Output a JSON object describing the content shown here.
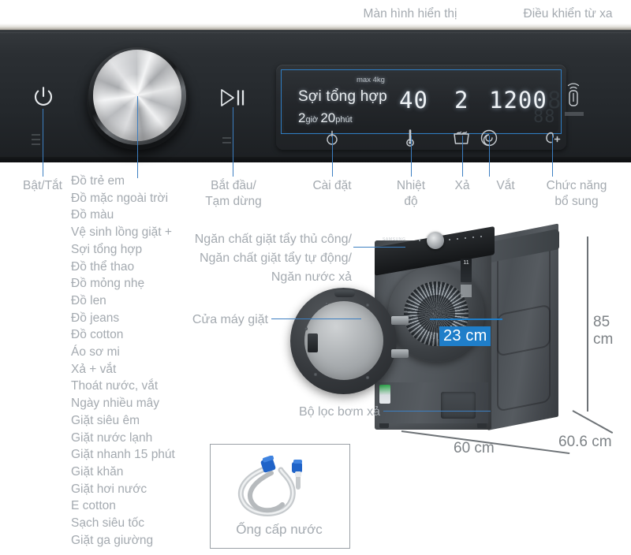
{
  "callouts": {
    "display": "Màn hình hiển thị",
    "remote": "Điều khiển từ xa",
    "power": "Bật/Tắt",
    "start_pause": "Bắt đầu/\nTạm dừng",
    "settings": "Cài đặt",
    "temperature": "Nhiệt\nđộ",
    "rinse": "Xả",
    "spin": "Vắt",
    "extra": "Chức năng\nbổ sung",
    "detergent_drawer": "Ngăn chất giặt tẩy thủ công/\nNgăn chất giặt tẩy tự động/\nNgăn nước xả",
    "door": "Cửa máy giặt",
    "pump_filter": "Bộ lọc bơm xả",
    "hose": "Ống cấp nước"
  },
  "programs": [
    "Đồ trẻ em",
    "Đồ mặc ngoài trời",
    "Đồ màu",
    "Vệ sinh lồng giặt +",
    "Sợi tổng hợp",
    "Đồ thể thao",
    "Đồ mỏng nhẹ",
    "Đồ len",
    "Đồ jeans",
    "Đồ cotton",
    "Áo sơ mi",
    "Xả + vắt",
    "Thoát nước, vắt",
    "Ngày nhiều mây",
    "Giặt siêu êm",
    "Giặt nước lạnh",
    "Giặt nhanh 15 phút",
    "Giặt khăn",
    "Giặt hơi nước",
    "E cotton",
    "Sạch siêu tốc",
    "Giặt ga giường"
  ],
  "display": {
    "program": "Sợi tổng hợp",
    "max_load": "max 4kg",
    "time_hours": "2",
    "time_hours_unit": "giờ",
    "time_minutes": "20",
    "time_minutes_unit": "phút",
    "temperature": "40",
    "rinse_count": "2",
    "spin_speed": "1200",
    "ghost_digit_1": "8",
    "ghost_digit_2": "88"
  },
  "dimensions": {
    "height": "85 cm",
    "width": "60 cm",
    "depth": "60.6 cm",
    "drum_opening": "23 cm"
  },
  "brand": "SAMSUNG",
  "energy_rating": "11",
  "colors": {
    "callout_line": "#2f7ec4",
    "badge": "#1f7ec9",
    "label_text": "#a4aab0",
    "panel_dark": "#24282c"
  }
}
